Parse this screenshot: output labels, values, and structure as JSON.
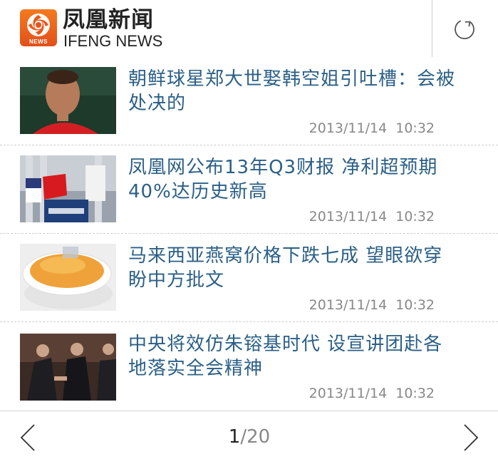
{
  "header": {
    "brand_cn": "凤凰新闻",
    "brand_en": "IFENG NEWS",
    "badge_text": "NEWS",
    "brand_color": "#e8551a",
    "refresh_icon": "refresh-icon"
  },
  "news": [
    {
      "title": "朝鲜球星郑大世娶韩空姐引吐槽：会被处决的",
      "time": "2013/11/14  10:32"
    },
    {
      "title": "凤凰网公布13年Q3财报 净利超预期40%达历史新高",
      "time": "2013/11/14  10:32"
    },
    {
      "title": "马来西亚燕窝价格下跌七成  望眼欲穿盼中方批文",
      "time": "2013/11/14  10:32"
    },
    {
      "title": "中央将效仿朱镕基时代 设宣讲团赴各地落实全会精神",
      "time": "2013/11/14  10:32"
    }
  ],
  "pager": {
    "current": "1",
    "total": "/20"
  },
  "colors": {
    "title_link": "#2b5f86",
    "meta_text": "#888888"
  },
  "icons": {
    "prev": "chevron-left-icon",
    "next": "chevron-right-icon"
  }
}
